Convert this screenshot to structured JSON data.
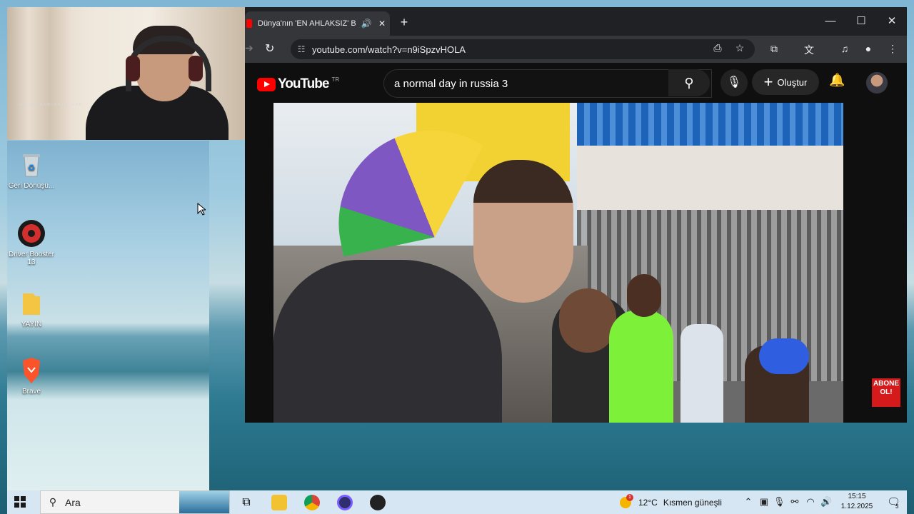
{
  "webcam": {
    "caption": "using ermidean son"
  },
  "desktop": {
    "icons": [
      {
        "label": "Geri Dönüşü...",
        "icon": "recycle-bin-icon"
      },
      {
        "label": "Driver Booster 13",
        "icon": "driver-booster-icon"
      },
      {
        "label": "YAYIN",
        "icon": "folder-icon"
      },
      {
        "label": "Brave",
        "icon": "brave-icon"
      }
    ]
  },
  "browser": {
    "tab": {
      "title": "Dünya'nın 'EN AHLAKSIZ' B",
      "sound_icon": "🔊",
      "close": "✕"
    },
    "new_tab": "+",
    "window": {
      "minimize": "—",
      "maximize": "☐",
      "close": "✕"
    },
    "url": "youtube.com/watch?v=n9iSpzvHOLA"
  },
  "youtube": {
    "logo_text": "YouTube",
    "country_code": "TR",
    "search_query": "a normal day in russia 3",
    "create_label": "Oluştur",
    "subscribe_overlay": "ABONE OL!",
    "accent": "#ff0000"
  },
  "taskbar": {
    "search_placeholder": "Ara",
    "weather": {
      "temp": "12°C",
      "desc": "Kısmen güneşli",
      "badge": "1"
    },
    "clock": {
      "time": "15:15",
      "date": "1.12.2025"
    },
    "notif_count": "3"
  }
}
